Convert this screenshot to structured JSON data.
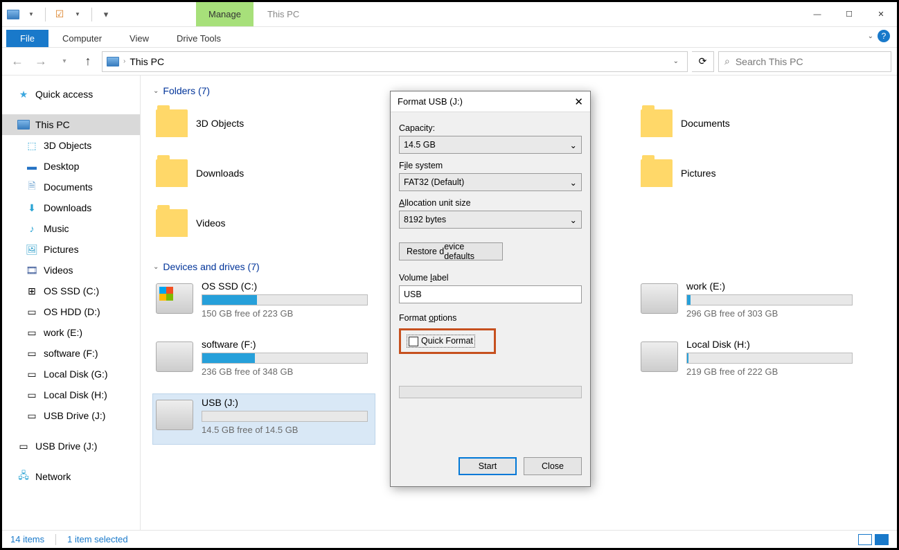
{
  "titlebar": {
    "title": "This PC"
  },
  "ribbon": {
    "manage": "Manage",
    "drive_tools": "Drive Tools",
    "file": "File",
    "computer": "Computer",
    "view": "View"
  },
  "address": {
    "location": "This PC"
  },
  "search": {
    "placeholder": "Search This PC"
  },
  "nav": {
    "quick_access": "Quick access",
    "this_pc": "This PC",
    "3d": "3D Objects",
    "desktop": "Desktop",
    "documents": "Documents",
    "downloads": "Downloads",
    "music": "Music",
    "pictures": "Pictures",
    "videos": "Videos",
    "os_ssd": "OS SSD (C:)",
    "os_hdd": "OS HDD (D:)",
    "work": "work (E:)",
    "software": "software (F:)",
    "local_g": "Local Disk (G:)",
    "local_h": "Local Disk (H:)",
    "usb_drive": "USB Drive (J:)",
    "usb_drive2": "USB Drive (J:)",
    "network": "Network"
  },
  "content": {
    "folders_header": "Folders (7)",
    "folders": {
      "col1": [
        "3D Objects",
        "Downloads",
        "Videos"
      ],
      "col3": [
        "Documents",
        "Pictures"
      ]
    },
    "drives_header": "Devices and drives (7)",
    "drives": {
      "c": {
        "name": "OS SSD (C:)",
        "free": "150 GB free of 223 GB",
        "pct": 33
      },
      "f": {
        "name": "software (F:)",
        "free": "236 GB free of 348 GB",
        "pct": 32
      },
      "j": {
        "name": "USB (J:)",
        "free": "14.5 GB free of 14.5 GB",
        "pct": 0
      },
      "e": {
        "name": "work (E:)",
        "free": "296 GB free of 303 GB",
        "pct": 2
      },
      "h": {
        "name": "Local Disk (H:)",
        "free": "219 GB free of 222 GB",
        "pct": 1
      }
    }
  },
  "status": {
    "items": "14 items",
    "selected": "1 item selected"
  },
  "dialog": {
    "title": "Format USB (J:)",
    "capacity_label": "Capacity:",
    "capacity_value": "14.5 GB",
    "fs_label_pre": "F",
    "fs_label_ul": "i",
    "fs_label_post": "le system",
    "fs_value": "FAT32 (Default)",
    "au_label_pre": "",
    "au_label_ul": "A",
    "au_label_post": "llocation unit size",
    "au_value": "8192 bytes",
    "restore": "Restore device defaults",
    "vol_label_pre": "Volume ",
    "vol_label_ul": "l",
    "vol_label_post": "abel",
    "vol_value": "USB",
    "opt_label_pre": "Format ",
    "opt_label_ul": "o",
    "opt_label_post": "ptions",
    "quick_format": "Quick Format",
    "start": "Start",
    "close": "Close"
  }
}
